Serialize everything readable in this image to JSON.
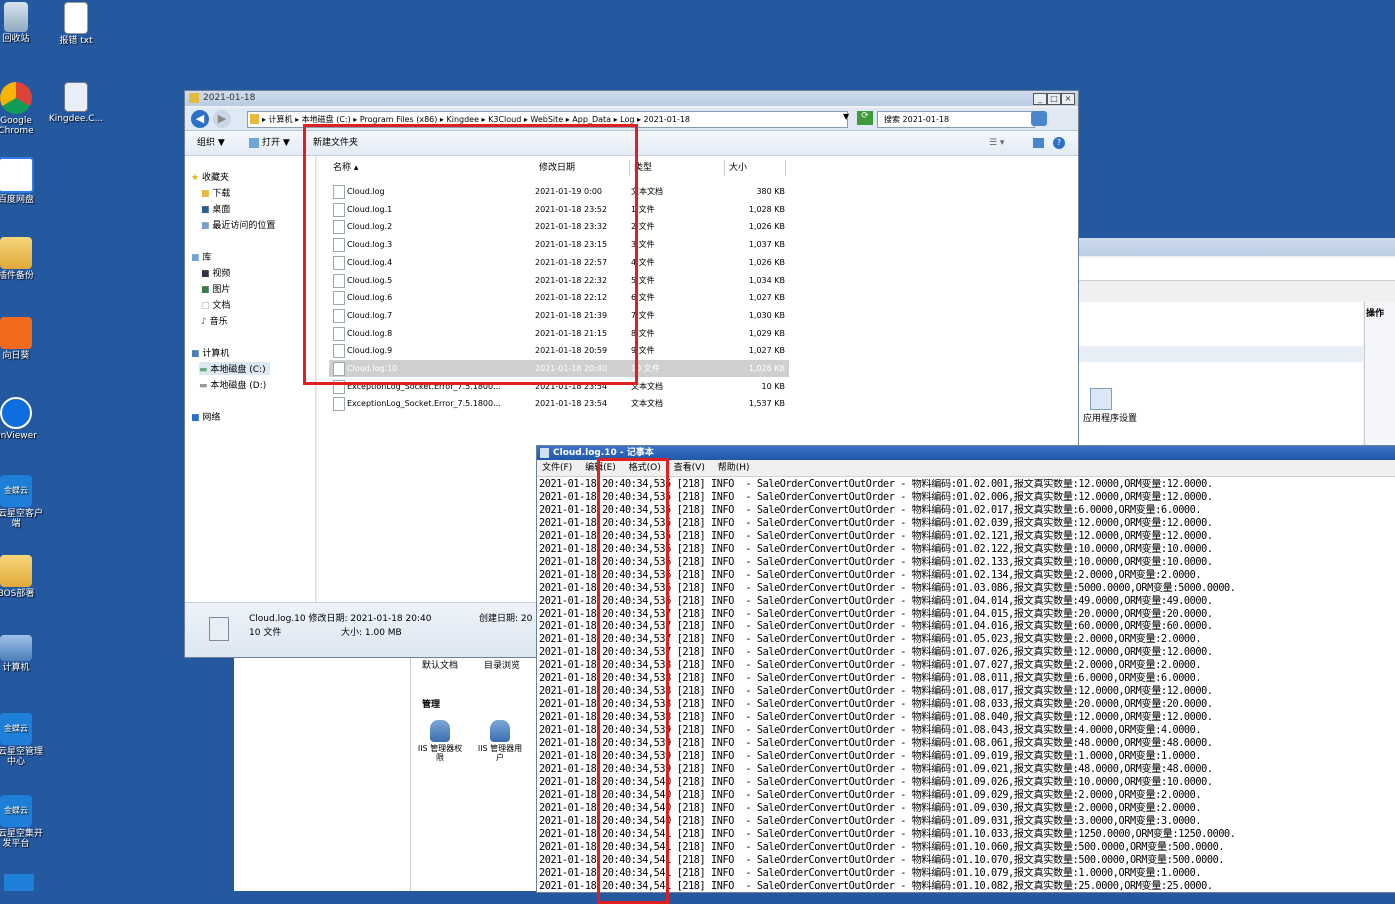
{
  "desktop": {
    "icons": [
      {
        "label": "回收站",
        "icon": "recycle-bin-icon"
      },
      {
        "label": "报错 txt",
        "icon": "text-file-icon"
      },
      {
        "label": "Google Chrome",
        "icon": "chrome-icon"
      },
      {
        "label": "Kingdee.C...",
        "icon": "kingdee-file-icon"
      },
      {
        "label": "百度网盘",
        "icon": "baidu-netdisk-icon"
      },
      {
        "label": "插件备份",
        "icon": "folder-icon"
      },
      {
        "label": "向日葵",
        "icon": "sunflower-icon"
      },
      {
        "label": "anViewer",
        "icon": "teamviewer-icon"
      },
      {
        "label": "蝶云星空客户端",
        "icon": "kingdee-cloud-icon"
      },
      {
        "label": "BOS部署",
        "icon": "folder-icon"
      },
      {
        "label": "计算机",
        "icon": "computer-icon"
      },
      {
        "label": "蝶云星空管理中心",
        "icon": "kingdee-cloud-icon"
      },
      {
        "label": "蝶云星空集开发平台",
        "icon": "kingdee-cloud-icon"
      }
    ],
    "cloud_badge": "金蝶云"
  },
  "explorer": {
    "title": "2021-01-18",
    "address": "▸ 计算机 ▸ 本地磁盘 (C:) ▸ Program Files (x86) ▸ Kingdee ▸ K3Cloud ▸ WebSite ▸ App_Data ▸ Log ▸ 2021-01-18",
    "search_placeholder": "搜索 2021-01-18",
    "toolbar": {
      "organize": "组织 ▼",
      "open": "打开 ▼",
      "new_folder": "新建文件夹"
    },
    "nav": {
      "favorites": "收藏夹",
      "downloads": "下载",
      "desktop": "桌面",
      "recent": "最近访问的位置",
      "libraries": "库",
      "videos": "视频",
      "pictures": "图片",
      "documents": "文档",
      "music": "音乐",
      "computer": "计算机",
      "drive_c": "本地磁盘 (C:)",
      "drive_d": "本地磁盘 (D:)",
      "network": "网络"
    },
    "columns": {
      "name": "名称",
      "modified": "修改日期",
      "type": "类型",
      "size": "大小"
    },
    "files": [
      {
        "name": "Cloud.log",
        "modified": "2021-01-19 0:00",
        "type": "文本文档",
        "size": "380 KB"
      },
      {
        "name": "Cloud.log.1",
        "modified": "2021-01-18 23:52",
        "type": "1 文件",
        "size": "1,028 KB"
      },
      {
        "name": "Cloud.log.2",
        "modified": "2021-01-18 23:32",
        "type": "2 文件",
        "size": "1,026 KB"
      },
      {
        "name": "Cloud.log.3",
        "modified": "2021-01-18 23:15",
        "type": "3 文件",
        "size": "1,037 KB"
      },
      {
        "name": "Cloud.log.4",
        "modified": "2021-01-18 22:57",
        "type": "4 文件",
        "size": "1,026 KB"
      },
      {
        "name": "Cloud.log.5",
        "modified": "2021-01-18 22:32",
        "type": "5 文件",
        "size": "1,034 KB"
      },
      {
        "name": "Cloud.log.6",
        "modified": "2021-01-18 22:12",
        "type": "6 文件",
        "size": "1,027 KB"
      },
      {
        "name": "Cloud.log.7",
        "modified": "2021-01-18 21:39",
        "type": "7 文件",
        "size": "1,030 KB"
      },
      {
        "name": "Cloud.log.8",
        "modified": "2021-01-18 21:15",
        "type": "8 文件",
        "size": "1,029 KB"
      },
      {
        "name": "Cloud.log.9",
        "modified": "2021-01-18 20:59",
        "type": "9 文件",
        "size": "1,027 KB"
      },
      {
        "name": "Cloud.log.10",
        "modified": "2021-01-18 20:40",
        "type": "10 文件",
        "size": "1,026 KB"
      },
      {
        "name": "ExceptionLog_Socket.Error_7.5.1800...",
        "modified": "2021-01-18 23:54",
        "type": "文本文档",
        "size": "10 KB"
      },
      {
        "name": "ExceptionLog_Socket.Error_7.5.1800...",
        "modified": "2021-01-18 23:54",
        "type": "文本文档",
        "size": "1,537 KB"
      }
    ],
    "details": {
      "line1": "Cloud.log.10 修改日期: 2021-01-18 20:40",
      "created": "创建日期: 20",
      "type": "10 文件",
      "size": "大小: 1.00 MB"
    }
  },
  "iis": {
    "ops": "操作",
    "app_settings": "应用程序设置",
    "default_doc": "默认文档",
    "dir_browse": "目录浏览",
    "manage": "管理",
    "iis_perm": "IIS 管理器权限",
    "iis_users": "IIS 管理器用户"
  },
  "notepad": {
    "title": "Cloud.log.10 - 记事本",
    "menu": [
      "文件(F)",
      "编辑(E)",
      "格式(O)",
      "查看(V)",
      "帮助(H)"
    ],
    "lines": [
      "2021-01-18 20:40:34,535 [218] INFO  - SaleOrderConvertOutOrder - 物料编码:01.02.001,报文真实数量:12.0000,ORM变量:12.0000.",
      "2021-01-18 20:40:34,535 [218] INFO  - SaleOrderConvertOutOrder - 物料编码:01.02.006,报文真实数量:12.0000,ORM变量:12.0000.",
      "2021-01-18 20:40:34,535 [218] INFO  - SaleOrderConvertOutOrder - 物料编码:01.02.017,报文真实数量:6.0000,ORM变量:6.0000.",
      "2021-01-18 20:40:34,535 [218] INFO  - SaleOrderConvertOutOrder - 物料编码:01.02.039,报文真实数量:12.0000,ORM变量:12.0000.",
      "2021-01-18 20:40:34,535 [218] INFO  - SaleOrderConvertOutOrder - 物料编码:01.02.121,报文真实数量:12.0000,ORM变量:12.0000.",
      "2021-01-18 20:40:34,536 [218] INFO  - SaleOrderConvertOutOrder - 物料编码:01.02.122,报文真实数量:10.0000,ORM变量:10.0000.",
      "2021-01-18 20:40:34,536 [218] INFO  - SaleOrderConvertOutOrder - 物料编码:01.02.133,报文真实数量:10.0000,ORM变量:10.0000.",
      "2021-01-18 20:40:34,536 [218] INFO  - SaleOrderConvertOutOrder - 物料编码:01.02.134,报文真实数量:2.0000,ORM变量:2.0000.",
      "2021-01-18 20:40:34,536 [218] INFO  - SaleOrderConvertOutOrder - 物料编码:01.03.086,报文真实数量:5000.0000,ORM变量:5000.0000.",
      "2021-01-18 20:40:34,536 [218] INFO  - SaleOrderConvertOutOrder - 物料编码:01.04.014,报文真实数量:49.0000,ORM变量:49.0000.",
      "2021-01-18 20:40:34,537 [218] INFO  - SaleOrderConvertOutOrder - 物料编码:01.04.015,报文真实数量:20.0000,ORM变量:20.0000.",
      "2021-01-18 20:40:34,537 [218] INFO  - SaleOrderConvertOutOrder - 物料编码:01.04.016,报文真实数量:60.0000,ORM变量:60.0000.",
      "2021-01-18 20:40:34,537 [218] INFO  - SaleOrderConvertOutOrder - 物料编码:01.05.023,报文真实数量:2.0000,ORM变量:2.0000.",
      "2021-01-18 20:40:34,537 [218] INFO  - SaleOrderConvertOutOrder - 物料编码:01.07.026,报文真实数量:12.0000,ORM变量:12.0000.",
      "2021-01-18 20:40:34,538 [218] INFO  - SaleOrderConvertOutOrder - 物料编码:01.07.027,报文真实数量:2.0000,ORM变量:2.0000.",
      "2021-01-18 20:40:34,538 [218] INFO  - SaleOrderConvertOutOrder - 物料编码:01.08.011,报文真实数量:6.0000,ORM变量:6.0000.",
      "2021-01-18 20:40:34,538 [218] INFO  - SaleOrderConvertOutOrder - 物料编码:01.08.017,报文真实数量:12.0000,ORM变量:12.0000.",
      "2021-01-18 20:40:34,538 [218] INFO  - SaleOrderConvertOutOrder - 物料编码:01.08.033,报文真实数量:20.0000,ORM变量:20.0000.",
      "2021-01-18 20:40:34,538 [218] INFO  - SaleOrderConvertOutOrder - 物料编码:01.08.040,报文真实数量:12.0000,ORM变量:12.0000.",
      "2021-01-18 20:40:34,539 [218] INFO  - SaleOrderConvertOutOrder - 物料编码:01.08.043,报文真实数量:4.0000,ORM变量:4.0000.",
      "2021-01-18 20:40:34,539 [218] INFO  - SaleOrderConvertOutOrder - 物料编码:01.08.061,报文真实数量:48.0000,ORM变量:48.0000.",
      "2021-01-18 20:40:34,539 [218] INFO  - SaleOrderConvertOutOrder - 物料编码:01.09.019,报文真实数量:1.0000,ORM变量:1.0000.",
      "2021-01-18 20:40:34,539 [218] INFO  - SaleOrderConvertOutOrder - 物料编码:01.09.021,报文真实数量:48.0000,ORM变量:48.0000.",
      "2021-01-18 20:40:34,540 [218] INFO  - SaleOrderConvertOutOrder - 物料编码:01.09.026,报文真实数量:10.0000,ORM变量:10.0000.",
      "2021-01-18 20:40:34,540 [218] INFO  - SaleOrderConvertOutOrder - 物料编码:01.09.029,报文真实数量:2.0000,ORM变量:2.0000.",
      "2021-01-18 20:40:34,540 [218] INFO  - SaleOrderConvertOutOrder - 物料编码:01.09.030,报文真实数量:2.0000,ORM变量:2.0000.",
      "2021-01-18 20:40:34,540 [218] INFO  - SaleOrderConvertOutOrder - 物料编码:01.09.031,报文真实数量:3.0000,ORM变量:3.0000.",
      "2021-01-18 20:40:34,541 [218] INFO  - SaleOrderConvertOutOrder - 物料编码:01.10.033,报文真实数量:1250.0000,ORM变量:1250.0000.",
      "2021-01-18 20:40:34,541 [218] INFO  - SaleOrderConvertOutOrder - 物料编码:01.10.060,报文真实数量:500.0000,ORM变量:500.0000.",
      "2021-01-18 20:40:34,541 [218] INFO  - SaleOrderConvertOutOrder - 物料编码:01.10.070,报文真实数量:500.0000,ORM变量:500.0000.",
      "2021-01-18 20:40:34,541 [218] INFO  - SaleOrderConvertOutOrder - 物料编码:01.10.079,报文真实数量:1.0000,ORM变量:1.0000.",
      "2021-01-18 20:40:34,541 [218] INFO  - SaleOrderConvertOutOrder - 物料编码:01.10.082,报文真实数量:25.0000,ORM变量:25.0000."
    ]
  }
}
